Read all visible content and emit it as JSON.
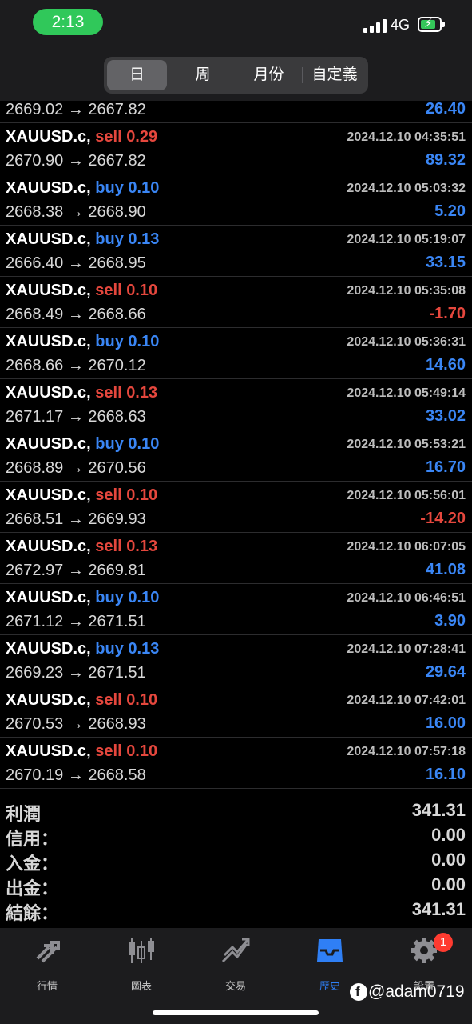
{
  "status": {
    "time": "2:13",
    "network": "4G"
  },
  "tabs": [
    {
      "label": "日"
    },
    {
      "label": "周"
    },
    {
      "label": "月份"
    },
    {
      "label": "自定義"
    }
  ],
  "partial_row": {
    "prices": "2669.02 → 2667.82",
    "profit": "26.40"
  },
  "rows": [
    {
      "symbol": "XAUUSD.c,",
      "side": "sell",
      "volume": "0.29",
      "time": "2024.12.10 04:35:51",
      "prices": "2670.90 → 2667.82",
      "profit": "89.32"
    },
    {
      "symbol": "XAUUSD.c,",
      "side": "buy",
      "volume": "0.10",
      "time": "2024.12.10 05:03:32",
      "prices": "2668.38 → 2668.90",
      "profit": "5.20"
    },
    {
      "symbol": "XAUUSD.c,",
      "side": "buy",
      "volume": "0.13",
      "time": "2024.12.10 05:19:07",
      "prices": "2666.40 → 2668.95",
      "profit": "33.15"
    },
    {
      "symbol": "XAUUSD.c,",
      "side": "sell",
      "volume": "0.10",
      "time": "2024.12.10 05:35:08",
      "prices": "2668.49 → 2668.66",
      "profit": "-1.70"
    },
    {
      "symbol": "XAUUSD.c,",
      "side": "buy",
      "volume": "0.10",
      "time": "2024.12.10 05:36:31",
      "prices": "2668.66 → 2670.12",
      "profit": "14.60"
    },
    {
      "symbol": "XAUUSD.c,",
      "side": "sell",
      "volume": "0.13",
      "time": "2024.12.10 05:49:14",
      "prices": "2671.17 → 2668.63",
      "profit": "33.02"
    },
    {
      "symbol": "XAUUSD.c,",
      "side": "buy",
      "volume": "0.10",
      "time": "2024.12.10 05:53:21",
      "prices": "2668.89 → 2670.56",
      "profit": "16.70"
    },
    {
      "symbol": "XAUUSD.c,",
      "side": "sell",
      "volume": "0.10",
      "time": "2024.12.10 05:56:01",
      "prices": "2668.51 → 2669.93",
      "profit": "-14.20"
    },
    {
      "symbol": "XAUUSD.c,",
      "side": "sell",
      "volume": "0.13",
      "time": "2024.12.10 06:07:05",
      "prices": "2672.97 → 2669.81",
      "profit": "41.08"
    },
    {
      "symbol": "XAUUSD.c,",
      "side": "buy",
      "volume": "0.10",
      "time": "2024.12.10 06:46:51",
      "prices": "2671.12 → 2671.51",
      "profit": "3.90"
    },
    {
      "symbol": "XAUUSD.c,",
      "side": "buy",
      "volume": "0.13",
      "time": "2024.12.10 07:28:41",
      "prices": "2669.23 → 2671.51",
      "profit": "29.64"
    },
    {
      "symbol": "XAUUSD.c,",
      "side": "sell",
      "volume": "0.10",
      "time": "2024.12.10 07:42:01",
      "prices": "2670.53 → 2668.93",
      "profit": "16.00"
    },
    {
      "symbol": "XAUUSD.c,",
      "side": "sell",
      "volume": "0.10",
      "time": "2024.12.10 07:57:18",
      "prices": "2670.19 → 2668.58",
      "profit": "16.10"
    }
  ],
  "summary": [
    {
      "label": "利潤",
      "value": "341.31"
    },
    {
      "label": "信用：",
      "value": "0.00"
    },
    {
      "label": "入金：",
      "value": "0.00"
    },
    {
      "label": "出金：",
      "value": "0.00"
    },
    {
      "label": "結餘：",
      "value": "341.31"
    }
  ],
  "bottom_tabs": [
    {
      "label": "行情",
      "icon": "quotes-arrows-icon"
    },
    {
      "label": "圖表",
      "icon": "candlestick-icon"
    },
    {
      "label": "交易",
      "icon": "trade-trend-icon"
    },
    {
      "label": "歷史",
      "icon": "history-inbox-icon"
    },
    {
      "label": "設置",
      "icon": "gear-icon"
    }
  ],
  "badge": "1",
  "watermark": "@adam0719",
  "colors": {
    "buy": "#3a86f5",
    "sell": "#e5473d",
    "active_tab": "#2f7ff5",
    "badge": "#ff3b30"
  }
}
